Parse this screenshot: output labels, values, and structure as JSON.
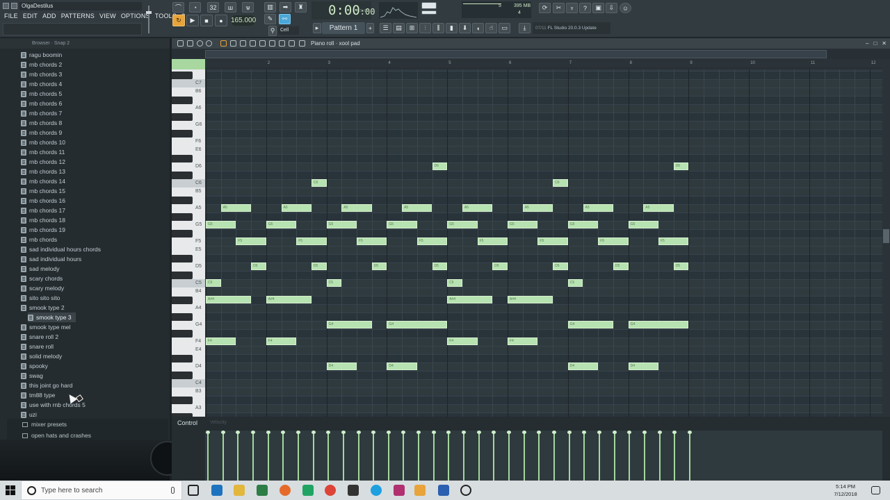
{
  "window": {
    "title": "OlgaDestilus"
  },
  "menu": [
    "FILE",
    "EDIT",
    "ADD",
    "PATTERNS",
    "VIEW",
    "OPTIONS",
    "TOOLS",
    "?"
  ],
  "transport": {
    "tempo": "165.000",
    "time": "0:00",
    "time_sub": ":00",
    "time_unit": "M:S:CS",
    "pattern": "Pattern 1",
    "snap": "Cell",
    "cpu_num": "5",
    "ram": "395 MB",
    "poly": "4"
  },
  "news": {
    "date": "07/11",
    "text": "FL Studio 20.0.3 Update"
  },
  "browser": {
    "header": "Browser · Snap 2",
    "items": [
      "ragu boomin",
      "rnb chords 2",
      "rnb chords 3",
      "rnb chords 4",
      "rnb chords 5",
      "rnb chords 6",
      "rnb chords 7",
      "rnb chords 8",
      "rnb chords 9",
      "rnb chords 10",
      "rnb chords 11",
      "rnb chords 12",
      "rnb chords 13",
      "rnb chords 14",
      "rnb chords 15",
      "rnb chords 16",
      "rnb chords 17",
      "rnb chords 18",
      "rnb chords 19",
      "rnb chords",
      "sad individual hours chords",
      "sad individual hours",
      "sad melody",
      "scary chords",
      "scary melody",
      "sito sito sito",
      "smook type 2",
      "smook type 3",
      "smook type mel",
      "snare roll 2",
      "snare roll",
      "solid melody",
      "spooky",
      "swag",
      "this joint go hard",
      "tm88 type",
      "use with rnb chords 5",
      "uzi"
    ],
    "highlighted": "smook type 3",
    "folders": [
      "mixer presets",
      "open hats and crashes"
    ]
  },
  "piano_roll": {
    "title": "Piano roll · xool pad",
    "bars": [
      "2",
      "3",
      "4",
      "5",
      "6",
      "7",
      "8",
      "9",
      "10",
      "11",
      "12"
    ],
    "keys": [
      "C7",
      "B6",
      "A6",
      "G6",
      "F6",
      "E6",
      "D6",
      "C6",
      "B5",
      "A5",
      "G5",
      "F5",
      "E5",
      "D5",
      "C5",
      "B4",
      "A4",
      "G4",
      "F4",
      "E4",
      "D4",
      "C4",
      "B3",
      "A3"
    ],
    "notes": [
      {
        "pitch": "D6",
        "start": 4.75,
        "len": 0.25
      },
      {
        "pitch": "D6",
        "start": 8.75,
        "len": 0.25
      },
      {
        "pitch": "C6",
        "start": 2.75,
        "len": 0.25
      },
      {
        "pitch": "C6",
        "start": 6.75,
        "len": 0.25
      },
      {
        "pitch": "A5",
        "start": 1.25,
        "len": 0.5
      },
      {
        "pitch": "A5",
        "start": 2.25,
        "len": 0.5
      },
      {
        "pitch": "A5",
        "start": 3.25,
        "len": 0.5
      },
      {
        "pitch": "A5",
        "start": 4.25,
        "len": 0.5
      },
      {
        "pitch": "A5",
        "start": 5.25,
        "len": 0.5
      },
      {
        "pitch": "A5",
        "start": 6.25,
        "len": 0.5
      },
      {
        "pitch": "A5",
        "start": 7.25,
        "len": 0.5
      },
      {
        "pitch": "A5",
        "start": 8.25,
        "len": 0.5
      },
      {
        "pitch": "G5",
        "start": 1.0,
        "len": 0.5
      },
      {
        "pitch": "G5",
        "start": 2.0,
        "len": 0.5
      },
      {
        "pitch": "G5",
        "start": 3.0,
        "len": 0.5
      },
      {
        "pitch": "G5",
        "start": 4.0,
        "len": 0.5
      },
      {
        "pitch": "G5",
        "start": 5.0,
        "len": 0.5
      },
      {
        "pitch": "G5",
        "start": 6.0,
        "len": 0.5
      },
      {
        "pitch": "G5",
        "start": 7.0,
        "len": 0.5
      },
      {
        "pitch": "G5",
        "start": 8.0,
        "len": 0.5
      },
      {
        "pitch": "F5",
        "start": 1.5,
        "len": 0.5
      },
      {
        "pitch": "F5",
        "start": 2.5,
        "len": 0.5
      },
      {
        "pitch": "F5",
        "start": 3.5,
        "len": 0.5
      },
      {
        "pitch": "F5",
        "start": 4.5,
        "len": 0.5
      },
      {
        "pitch": "F5",
        "start": 5.5,
        "len": 0.5
      },
      {
        "pitch": "F5",
        "start": 6.5,
        "len": 0.5
      },
      {
        "pitch": "F5",
        "start": 7.5,
        "len": 0.5
      },
      {
        "pitch": "F5",
        "start": 8.5,
        "len": 0.5
      },
      {
        "pitch": "D5",
        "start": 1.75,
        "len": 0.25
      },
      {
        "pitch": "D5",
        "start": 2.75,
        "len": 0.25
      },
      {
        "pitch": "D5",
        "start": 3.75,
        "len": 0.25
      },
      {
        "pitch": "D5",
        "start": 4.75,
        "len": 0.25
      },
      {
        "pitch": "D5",
        "start": 5.75,
        "len": 0.25
      },
      {
        "pitch": "D5",
        "start": 6.75,
        "len": 0.25
      },
      {
        "pitch": "D5",
        "start": 7.75,
        "len": 0.25
      },
      {
        "pitch": "D5",
        "start": 8.75,
        "len": 0.25
      },
      {
        "pitch": "C5",
        "start": 1.0,
        "len": 0.25
      },
      {
        "pitch": "C5",
        "start": 3.0,
        "len": 0.25
      },
      {
        "pitch": "C5",
        "start": 5.0,
        "len": 0.25
      },
      {
        "pitch": "C5",
        "start": 7.0,
        "len": 0.25
      },
      {
        "pitch": "A#4",
        "start": 1.0,
        "len": 0.75
      },
      {
        "pitch": "A#4",
        "start": 2.0,
        "len": 0.75
      },
      {
        "pitch": "A#4",
        "start": 5.0,
        "len": 0.75
      },
      {
        "pitch": "A#4",
        "start": 6.0,
        "len": 0.75
      },
      {
        "pitch": "G4",
        "start": 3.0,
        "len": 0.75
      },
      {
        "pitch": "G4",
        "start": 4.0,
        "len": 1.0
      },
      {
        "pitch": "G4",
        "start": 7.0,
        "len": 0.75
      },
      {
        "pitch": "G4",
        "start": 8.0,
        "len": 1.0
      },
      {
        "pitch": "F4",
        "start": 1.0,
        "len": 0.5
      },
      {
        "pitch": "F4",
        "start": 2.0,
        "len": 0.5
      },
      {
        "pitch": "F4",
        "start": 5.0,
        "len": 0.5
      },
      {
        "pitch": "F4",
        "start": 6.0,
        "len": 0.5
      },
      {
        "pitch": "D4",
        "start": 3.0,
        "len": 0.5
      },
      {
        "pitch": "D4",
        "start": 4.0,
        "len": 0.5
      },
      {
        "pitch": "D4",
        "start": 7.0,
        "len": 0.5
      },
      {
        "pitch": "D4",
        "start": 8.0,
        "len": 0.5
      }
    ],
    "velocity_count": 33
  },
  "control": {
    "label": "Control",
    "target": "Velocity"
  },
  "taskbar": {
    "search_placeholder": "Type here to search",
    "time": "5:14 PM",
    "date": "7/12/2018"
  },
  "colors": {
    "note": "#b7e2b1",
    "accent": "#e8a43a",
    "grid": "#2f3a3f"
  }
}
